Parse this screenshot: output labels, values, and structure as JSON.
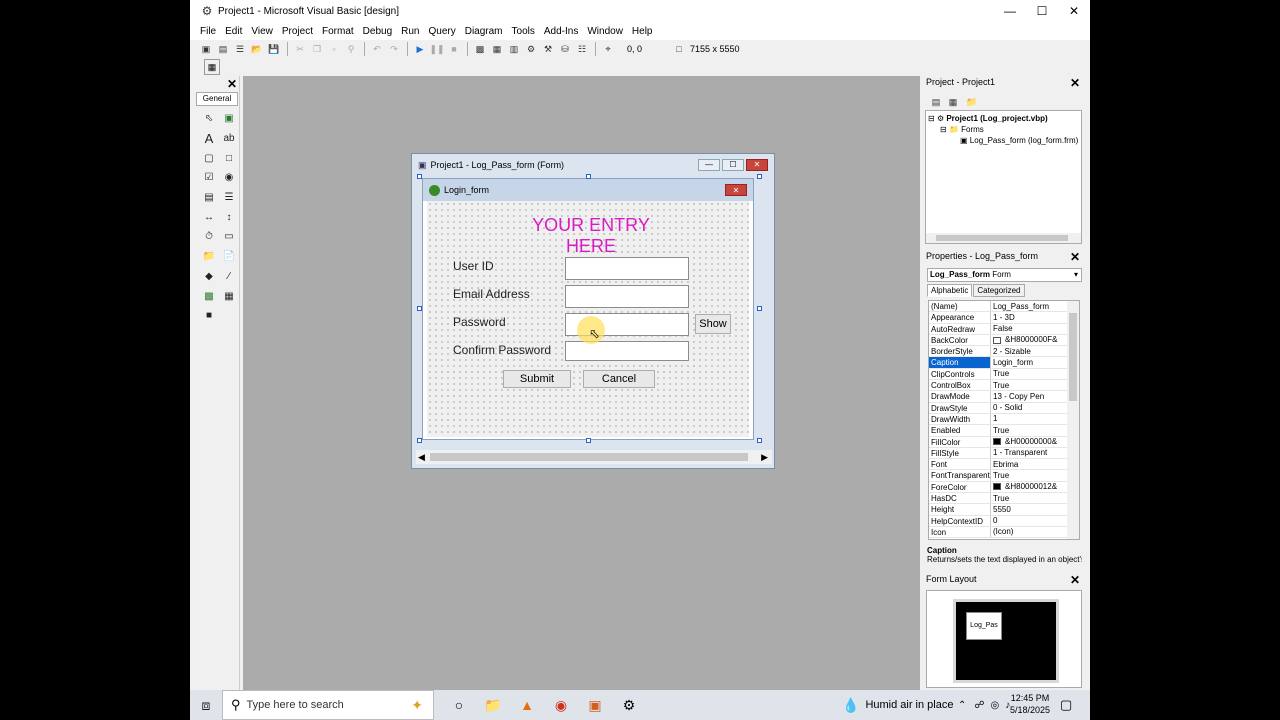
{
  "window": {
    "title": "Project1 - Microsoft Visual Basic [design]",
    "icon": "vb-icon",
    "controls": [
      "minimize-icon",
      "maximize-icon",
      "close-icon"
    ]
  },
  "menu": [
    "File",
    "Edit",
    "View",
    "Project",
    "Format",
    "Debug",
    "Run",
    "Query",
    "Diagram",
    "Tools",
    "Add-Ins",
    "Window",
    "Help"
  ],
  "toolbar": {
    "coords": "0, 0",
    "size": "7155 x 5550"
  },
  "toolbox": {
    "tab": "General"
  },
  "form_window": {
    "title": "Project1 - Log_Pass_form (Form)",
    "form_caption": "Login_form",
    "heading": "YOUR ENTRY HERE",
    "labels": {
      "user_id": "User ID",
      "email": "Email Address",
      "password": "Password",
      "confirm": "Confirm Password"
    },
    "buttons": {
      "show": "Show",
      "submit": "Submit",
      "cancel": "Cancel"
    }
  },
  "project_panel": {
    "title": "Project - Project1",
    "root": "Project1 (Log_project.vbp)",
    "folder": "Forms",
    "form": "Log_Pass_form (log_form.frm)"
  },
  "properties_panel": {
    "title": "Properties - Log_Pass_form",
    "object": "Log_Pass_form",
    "object_type": "Form",
    "tabs": [
      "Alphabetic",
      "Categorized"
    ],
    "rows": [
      {
        "name": "(Name)",
        "value": "Log_Pass_form"
      },
      {
        "name": "Appearance",
        "value": "1 - 3D"
      },
      {
        "name": "AutoRedraw",
        "value": "False"
      },
      {
        "name": "BackColor",
        "value": "&H8000000F&",
        "swatch": "#ffffff"
      },
      {
        "name": "BorderStyle",
        "value": "2 - Sizable"
      },
      {
        "name": "Caption",
        "value": "Login_form",
        "selected": true
      },
      {
        "name": "ClipControls",
        "value": "True"
      },
      {
        "name": "ControlBox",
        "value": "True"
      },
      {
        "name": "DrawMode",
        "value": "13 - Copy Pen"
      },
      {
        "name": "DrawStyle",
        "value": "0 - Solid"
      },
      {
        "name": "DrawWidth",
        "value": "1"
      },
      {
        "name": "Enabled",
        "value": "True"
      },
      {
        "name": "FillColor",
        "value": "&H00000000&",
        "swatch": "#000000"
      },
      {
        "name": "FillStyle",
        "value": "1 - Transparent"
      },
      {
        "name": "Font",
        "value": "Ebrima"
      },
      {
        "name": "FontTransparent",
        "value": "True"
      },
      {
        "name": "ForeColor",
        "value": "&H80000012&",
        "swatch": "#000000"
      },
      {
        "name": "HasDC",
        "value": "True"
      },
      {
        "name": "Height",
        "value": "5550"
      },
      {
        "name": "HelpContextID",
        "value": "0"
      },
      {
        "name": "Icon",
        "value": "(Icon)"
      }
    ],
    "desc_title": "Caption",
    "desc_text": "Returns/sets the text displayed in an object's"
  },
  "form_layout": {
    "title": "Form Layout",
    "mini_label": "Log_Pas"
  },
  "taskbar": {
    "search_placeholder": "Type here to search",
    "weather": "Humid air in place",
    "time": "12:45 PM",
    "date": "5/18/2025"
  },
  "colors": {
    "heading": "#d81bc5",
    "selection": "#0a64d0",
    "workspace": "#ababab"
  }
}
